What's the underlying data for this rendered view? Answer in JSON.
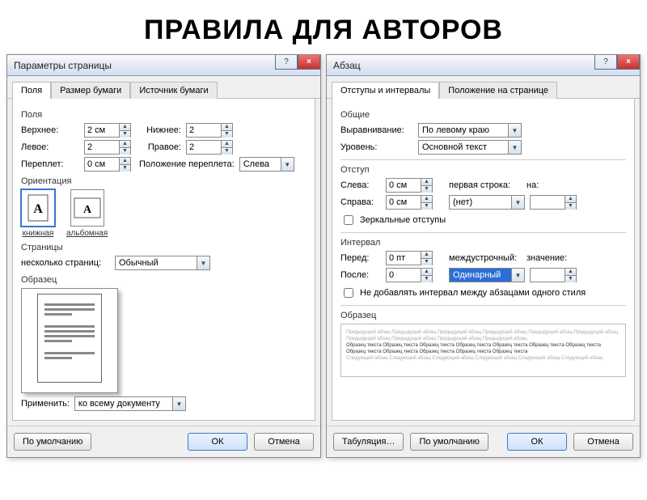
{
  "page_title": "ПРАВИЛА ДЛЯ АВТОРОВ",
  "left": {
    "title": "Параметры страницы",
    "help": "?",
    "close": "×",
    "tabs": [
      "Поля",
      "Размер бумаги",
      "Источник бумаги"
    ],
    "fields_group": "Поля",
    "top_label": "Верхнее:",
    "top_value": "2 см",
    "bottom_label": "Нижнее:",
    "bottom_value": "2",
    "left_label": "Левое:",
    "left_value": "2",
    "right_label": "Правое:",
    "right_value": "2",
    "gutter_label": "Переплет:",
    "gutter_value": "0 см",
    "gutter_pos_label": "Положение переплета:",
    "gutter_pos_value": "Слева",
    "orientation_group": "Ориентация",
    "orient_portrait": "книжная",
    "orient_landscape": "альбомная",
    "pages_group": "Страницы",
    "multi_pages_label": "несколько страниц:",
    "multi_pages_value": "Обычный",
    "preview_group": "Образец",
    "apply_label": "Применить:",
    "apply_value": "ко всему документу",
    "defaults_btn": "По умолчанию",
    "ok_btn": "ОК",
    "cancel_btn": "Отмена"
  },
  "right": {
    "title": "Абзац",
    "help": "?",
    "close": "×",
    "tabs": [
      "Отступы и интервалы",
      "Положение на странице"
    ],
    "general_group": "Общие",
    "align_label": "Выравнивание:",
    "align_value": "По левому краю",
    "level_label": "Уровень:",
    "level_value": "Основной текст",
    "indent_group": "Отступ",
    "ind_left_label": "Слева:",
    "ind_left_value": "0 см",
    "ind_right_label": "Справа:",
    "ind_right_value": "0 см",
    "firstline_label": "первая строка:",
    "firstline_value": "(нет)",
    "by_label": "на:",
    "by_value": "",
    "mirror_label": "Зеркальные отступы",
    "spacing_group": "Интервал",
    "before_label": "Перед:",
    "before_value": "0 пт",
    "after_label": "После:",
    "after_value": "0",
    "linespacing_label": "междустрочный:",
    "linespacing_value": "Одинарный",
    "value_label": "значение:",
    "value_value": "",
    "dont_add_space": "Не добавлять интервал между абзацами одного стиля",
    "preview_group": "Образец",
    "sample_light": "Предыдущий абзац Предыдущий абзац Предыдущий абзац Предыдущий абзац Предыдущий абзац Предыдущий абзац Предыдущий абзац Предыдущий абзац Предыдущий абзац Предыдущий абзац",
    "sample_dark": "Образец текста Образец текста Образец текста Образец текста Образец текста Образец текста Образец текста Образец текста Образец текста Образец текста Образец текста Образец текста",
    "sample_light2": "Следующий абзац Следующий абзац Следующий абзац Следующий абзац Следующий абзац Следующий абзац",
    "tabs_btn": "Табуляция…",
    "defaults_btn": "По умолчанию",
    "ok_btn": "ОК",
    "cancel_btn": "Отмена"
  }
}
